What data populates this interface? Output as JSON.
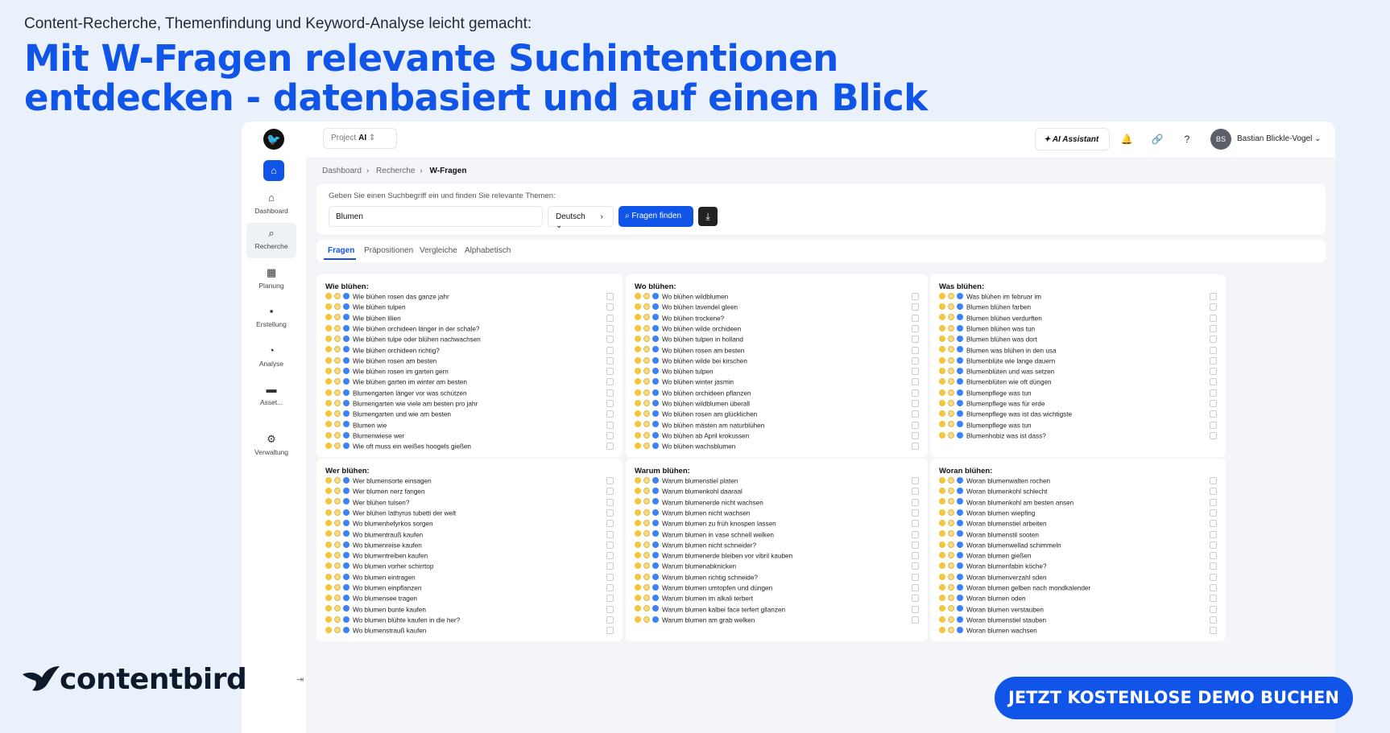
{
  "hero": {
    "eyebrow": "Content-Recherche, Themenfindung und Keyword-Analyse leicht gemacht:",
    "headline_1": "Mit W-Fragen relevante Suchintentionen",
    "headline_2": "entdecken - datenbasiert und auf einen Blick"
  },
  "app": {
    "project_label": "Project",
    "project_value": "AI",
    "ai_assistant": "AI Assistant",
    "avatar_initials": "BS",
    "user_name": "Bastian Blickle-Vogel",
    "sidebar": [
      "Dashboard",
      "Recherche",
      "Planung",
      "Erstellung",
      "Analyse",
      "Asset...",
      "Verwaltung"
    ],
    "breadcrumb": [
      "Dashboard",
      "Recherche",
      "W-Fragen"
    ],
    "search": {
      "hint": "Geben Sie einen Suchbegriff ein und finden Sie relevante Themen:",
      "value": "Blumen",
      "language": "Deutsch",
      "find_label": "Fragen finden"
    },
    "tabs": [
      "Fragen",
      "Präpositionen",
      "Vergleiche",
      "Alphabetisch"
    ],
    "cards": [
      {
        "title": "Wie blühen:",
        "items": [
          "Wie blühen rosen das ganze jahr",
          "Wie blühen tulpen",
          "Wie blühen lilien",
          "Wie blühen orchideen länger in der schale?",
          "Wie blühen tulpe oder blühen nachwachsen",
          "Wie blühen orchideen richtig?",
          "Wie blühen rosen am besten",
          "Wie blühen rosen im garten gern",
          "Wie blühen garten im winter am besten",
          "Blumengarten länger vor was schützen",
          "Blumengarten wie viele am besten pro jahr",
          "Blumengarten und wie am besten",
          "Blumen wie",
          "Blumenwiese wer",
          "Wie oft muss ein weißes hoogels gießen"
        ]
      },
      {
        "title": "Wo blühen:",
        "items": [
          "Wo blühen wildblumen",
          "Wo blühen lavendel gleen",
          "Wo blühen trockene?",
          "Wo blühen wilde orchideen",
          "Wo blühen tulpen in holland",
          "Wo blühen rosen am besten",
          "Wo blühen wilde bei kirschen",
          "Wo blühen tulpen",
          "Wo blühen winter jasmin",
          "Wo blühen orchideen pflanzen",
          "Wo blühen wildblumen überall",
          "Wo blühen rosen am glücklichen",
          "Wo blühen mästen am naturblühen",
          "Wo blühen ab April krokussen",
          "Wo blühen wachsblumen"
        ]
      },
      {
        "title": "Was blühen:",
        "items": [
          "Was blühen im februar im",
          "Blumen blühen farben",
          "Blumen blühen verdurften",
          "Blumen blühen was tun",
          "Blumen blühen was dort",
          "Blumen was blühen in den usa",
          "Blumenblüte wie lange dauern",
          "Blumenblüten und was setzen",
          "Blumenblüten wie oft düngen",
          "Blumenpflege was tun",
          "Blumenpflege was für erde",
          "Blumenpflege was ist das wichtigste",
          "Blumenpflege was tun",
          "Blumenhobiz was ist dass?"
        ]
      },
      {
        "title": "Wer blühen:",
        "items": [
          "Wer blumensorte einsagen",
          "Wer blumen nerz fangen",
          "Wer blühen tulsen?",
          "Wer blühen lathyrus tubetti der welt",
          "Wo blumenhefyrkos sorgen",
          "Wo blumentrauß kaufen",
          "Wo blumenreise kaufen",
          "Wo blumentreiben kaufen",
          "Wo blumen vorher schirrtop",
          "Wo blumen eintragen",
          "Wo blumen einpflanzen",
          "Wo blumensee tragen",
          "Wo blumen bunte kaufen",
          "Wo blumen blühte kaufen in die her?",
          "Wo blumenstrauß kaufen"
        ]
      },
      {
        "title": "Warum blühen:",
        "items": [
          "Warum blumenstiel platen",
          "Warum blumenkohl daaraal",
          "Warum blumenerde nicht wachsen",
          "Warum blumen nicht wachsen",
          "Warum blumen zu früh knospen lassen",
          "Warum blumen in vase schnell welken",
          "Warum blumen nicht schneider?",
          "Warum blumenerde bleiben vor vibril kauben",
          "Warum blumenabknicken",
          "Warum blumen richtig schneide?",
          "Warum blumen umtopfen und düngen",
          "Warum blumen im alkali terbert",
          "Warum blumen kalbei face terfert gllanzen",
          "Warum blumen am grab welken"
        ]
      },
      {
        "title": "Woran blühen:",
        "items": [
          "Woran blumenwalten rochen",
          "Woran blumenkohl schlecht",
          "Woran blumenkohl am besten ansen",
          "Woran blumen wiepfing",
          "Woran blumenstiel arbeiten",
          "Woran blumenstil sooten",
          "Woran blumenwellad schimmeln",
          "Woran blumen gießen",
          "Woran blumenfabin köche?",
          "Woran blumenverzahl sden",
          "Woran blumen gelben nach mondkalender",
          "Woran blumen oden",
          "Woran blumen verstauben",
          "Woran blumenstiel stauben",
          "Woran blumen wachsen"
        ]
      }
    ]
  },
  "brand": "contentbird",
  "cta": "JETZT KOSTENLOSE DEMO BUCHEN",
  "colors": {
    "accent": "#1054e8",
    "background": "#eaf1fb"
  }
}
